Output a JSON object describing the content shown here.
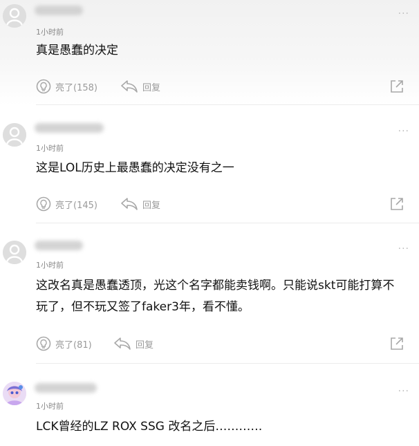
{
  "comments": [
    {
      "time": "1小时前",
      "text": "真是愚蠢的决定",
      "like_label": "亮了(158)",
      "reply_label": "回复"
    },
    {
      "time": "1小时前",
      "text": "这是LOL历史上最愚蠢的决定没有之一",
      "like_label": "亮了(145)",
      "reply_label": "回复"
    },
    {
      "time": "1小时前",
      "text": "这改名真是愚蠢透顶，光这个名字都能卖钱啊。只能说skt可能打算不玩了，但不玩又签了faker3年，看不懂。",
      "like_label": "亮了(81)",
      "reply_label": "回复"
    },
    {
      "time": "1小时前",
      "text": "LCK曾经的LZ ROX SSG 改名之后…………"
    }
  ],
  "more_glyph": "···",
  "colors": {
    "icon_gray": "#a8a8a8",
    "text": "#111111",
    "meta": "#888888"
  }
}
